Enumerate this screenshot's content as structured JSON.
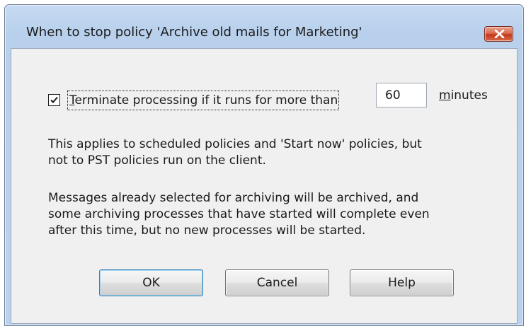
{
  "window": {
    "title": "When to stop policy 'Archive old mails for Marketing'",
    "close_icon": "close-icon"
  },
  "option": {
    "checked": true,
    "label_mnemonic": "T",
    "label_rest": "erminate processing if it runs for more than",
    "minutes_value": "60",
    "units_mnemonic": "m",
    "units_rest": "inutes"
  },
  "info": {
    "para1": [
      "This applies to scheduled policies and 'Start now' policies, but",
      "not to PST policies run on the client."
    ],
    "para2": [
      "Messages already selected for archiving will be archived, and",
      "some archiving processes that have started will complete even",
      "after this time, but no new processes will be started."
    ]
  },
  "buttons": {
    "ok": "OK",
    "cancel": "Cancel",
    "help": "Help"
  },
  "colors": {
    "titlebar": "#bad2ee",
    "client": "#f0f0f0",
    "close_button": "#c2391c"
  }
}
